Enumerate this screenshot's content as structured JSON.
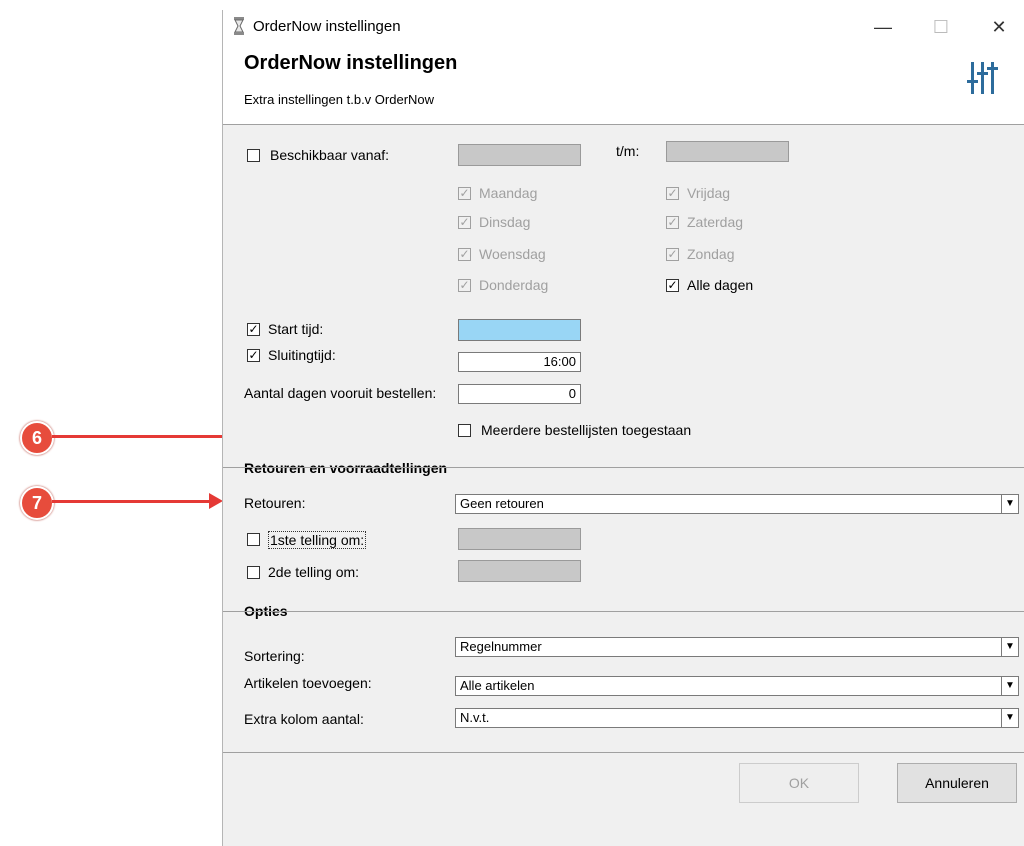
{
  "window": {
    "title": "OrderNow instellingen",
    "controls": {
      "minimize": "—",
      "maximize": "☐",
      "close": "✕"
    }
  },
  "header": {
    "title": "OrderNow instellingen",
    "subtitle": "Extra instellingen t.b.v OrderNow",
    "icon": "sliders-icon"
  },
  "availability": {
    "from_label": "Beschikbaar vanaf:",
    "from_checked": false,
    "to_label": "t/m:",
    "days": [
      {
        "label": "Maandag",
        "checked": true,
        "enabled": false
      },
      {
        "label": "Dinsdag",
        "checked": true,
        "enabled": false
      },
      {
        "label": "Woensdag",
        "checked": true,
        "enabled": false
      },
      {
        "label": "Donderdag",
        "checked": true,
        "enabled": false
      },
      {
        "label": "Vrijdag",
        "checked": true,
        "enabled": false
      },
      {
        "label": "Zaterdag",
        "checked": true,
        "enabled": false
      },
      {
        "label": "Zondag",
        "checked": true,
        "enabled": false
      },
      {
        "label": "Alle dagen",
        "checked": true,
        "enabled": true
      }
    ]
  },
  "times": {
    "start_label": "Start tijd:",
    "start_checked": true,
    "start_value": "",
    "close_label": "Sluitingtijd:",
    "close_checked": true,
    "close_value": "16:00",
    "days_ahead_label": "Aantal dagen vooruit bestellen:",
    "days_ahead_value": "0",
    "multiple_lists_label": "Meerdere bestellijsten toegestaan",
    "multiple_lists_checked": false
  },
  "returns": {
    "section_title": "Retouren en voorraadtellingen",
    "retouren_label": "Retouren:",
    "retouren_value": "Geen retouren",
    "count1_label": "1ste telling om:",
    "count1_checked": false,
    "count2_label": "2de telling om:",
    "count2_checked": false
  },
  "options": {
    "section_title": "Opties",
    "sort_label": "Sortering:",
    "sort_value": "Regelnummer",
    "add_label": "Artikelen toevoegen:",
    "add_value": "Alle artikelen",
    "extra_label": "Extra kolom aantal:",
    "extra_value": "N.v.t."
  },
  "buttons": {
    "ok": "OK",
    "cancel": "Annuleren"
  },
  "annotations": [
    {
      "number": "6"
    },
    {
      "number": "7"
    }
  ],
  "colors": {
    "annotation": "#e53935",
    "highlight_field": "#99d6f5",
    "disabled_field": "#c8c8c8"
  }
}
